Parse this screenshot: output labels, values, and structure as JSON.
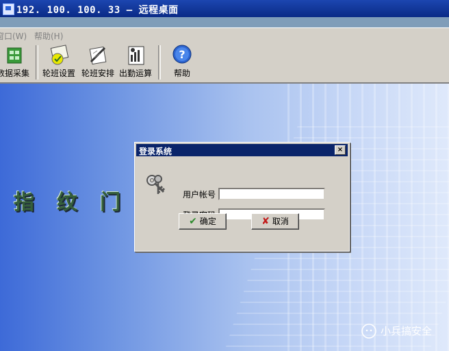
{
  "window": {
    "title": "192. 100. 100. 33 – 远程桌面"
  },
  "menu": [
    "窗口(W)",
    "帮助(H)"
  ],
  "toolbar": [
    {
      "label": "数据采集",
      "icon": "data-collect-icon"
    },
    {
      "label": "轮班设置",
      "icon": "shift-settings-icon"
    },
    {
      "label": "轮班安排",
      "icon": "shift-schedule-icon"
    },
    {
      "label": "出勤运算",
      "icon": "attendance-calc-icon"
    },
    {
      "label": "帮助",
      "icon": "help-icon"
    }
  ],
  "banner": {
    "text": "指纹门禁考勤管理"
  },
  "dialog": {
    "title": "登录系统",
    "close": "×",
    "account_label": "用户帐号",
    "password_label": "登录密码",
    "account_value": "",
    "password_value": "",
    "ok_label": "确定",
    "cancel_label": "取消"
  },
  "watermark": {
    "text": "小兵搞安全"
  }
}
